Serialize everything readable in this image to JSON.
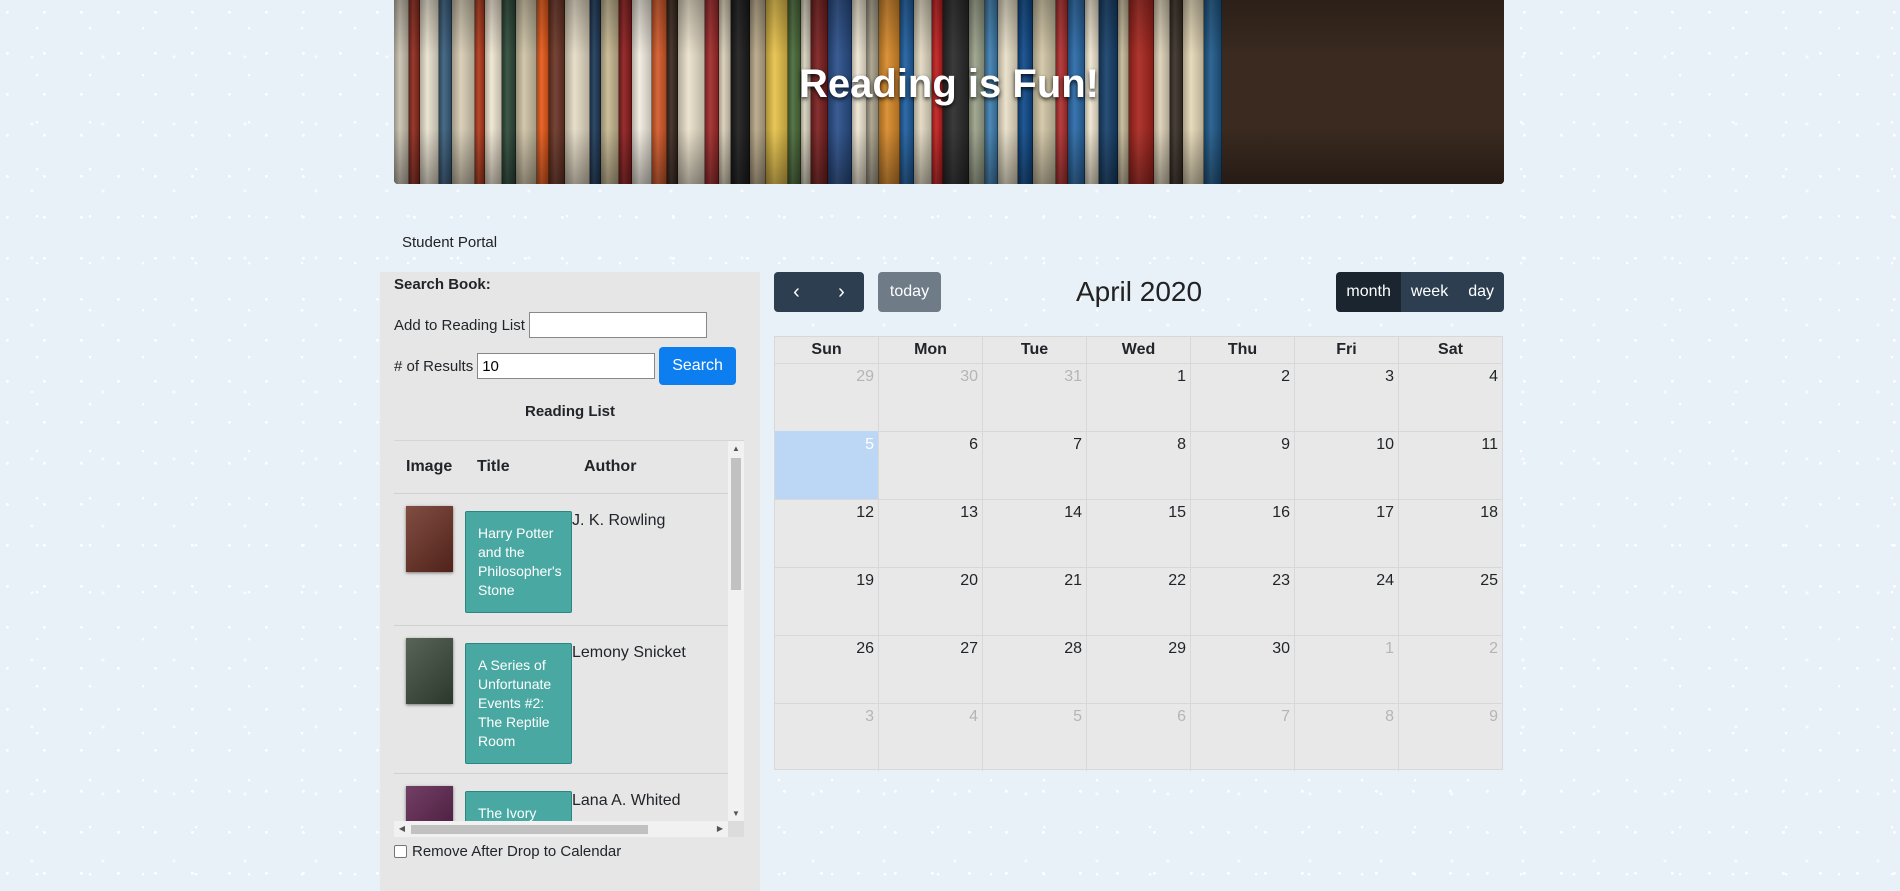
{
  "banner": {
    "title": "Reading is Fun!",
    "spine_colors": [
      "#c9c2b0",
      "#8e2b1e",
      "#e9e2cf",
      "#3a5f7d",
      "#d8cdb5",
      "#b23a1c",
      "#f0e6d2",
      "#2e4a3a",
      "#cfc3a6",
      "#e85a1a",
      "#6b3526",
      "#e6dcc6",
      "#1f3b5a",
      "#c7b892",
      "#8d1e1e",
      "#f2ece0",
      "#d45a2a",
      "#3c2a20",
      "#ece2cc",
      "#a02a2a",
      "#d9cfb8",
      "#1c1c1c",
      "#b8a888",
      "#e7c24a",
      "#4a6a3a",
      "#d7d0bc",
      "#7a2020",
      "#2a4f8a",
      "#efe7d4",
      "#a8a08a",
      "#d88a2a",
      "#1f5fa0",
      "#e2d9c2",
      "#c02020",
      "#2a2a2a",
      "#9aa28a",
      "#3f7fb0",
      "#e9e0c8",
      "#0f4a8a",
      "#d2c6a6",
      "#b03030",
      "#2a6aa8",
      "#efe6d0",
      "#16406a",
      "#c5b99a",
      "#a8261e",
      "#ddd2b8",
      "#3a3028",
      "#e6d9b8",
      "#205a8a"
    ]
  },
  "portal_label": "Student Portal",
  "search": {
    "title": "Search Book:",
    "add_label": "Add to Reading List",
    "add_value": "",
    "results_label": "# of Results",
    "results_value": "10",
    "search_button": "Search"
  },
  "reading_list": {
    "title": "Reading List",
    "headers": {
      "image": "Image",
      "title": "Title",
      "author": "Author"
    },
    "rows": [
      {
        "title": "Harry Potter and the Philosopher's Stone",
        "author": "J. K. Rowling",
        "cover_color": "#6b2e22"
      },
      {
        "title": "A Series of Unfortunate Events #2: The Reptile Room",
        "author": "Lemony Snicket",
        "cover_color": "#3a4a3a"
      },
      {
        "title": "The Ivory Tower and Harry Potter",
        "author": "Lana A. Whited",
        "cover_color": "#5a1e4a"
      }
    ],
    "remove_label": "Remove After Drop to Calendar"
  },
  "calendar": {
    "title": "April 2020",
    "today_button": "today",
    "views": [
      "month",
      "week",
      "day"
    ],
    "active_view": "month",
    "days_of_week": [
      "Sun",
      "Mon",
      "Tue",
      "Wed",
      "Thu",
      "Fri",
      "Sat"
    ],
    "weeks": [
      [
        "29",
        "30",
        "31",
        "1",
        "2",
        "3",
        "4"
      ],
      [
        "5",
        "6",
        "7",
        "8",
        "9",
        "10",
        "11"
      ],
      [
        "12",
        "13",
        "14",
        "15",
        "16",
        "17",
        "18"
      ],
      [
        "19",
        "20",
        "21",
        "22",
        "23",
        "24",
        "25"
      ],
      [
        "26",
        "27",
        "28",
        "29",
        "30",
        "1",
        "2"
      ],
      [
        "3",
        "4",
        "5",
        "6",
        "7",
        "8",
        "9"
      ]
    ],
    "other_month": [
      [
        true,
        true,
        true,
        false,
        false,
        false,
        false
      ],
      [
        false,
        false,
        false,
        false,
        false,
        false,
        false
      ],
      [
        false,
        false,
        false,
        false,
        false,
        false,
        false
      ],
      [
        false,
        false,
        false,
        false,
        false,
        false,
        false
      ],
      [
        false,
        false,
        false,
        false,
        false,
        true,
        true
      ],
      [
        true,
        true,
        true,
        true,
        true,
        true,
        true
      ]
    ],
    "today": "5"
  }
}
